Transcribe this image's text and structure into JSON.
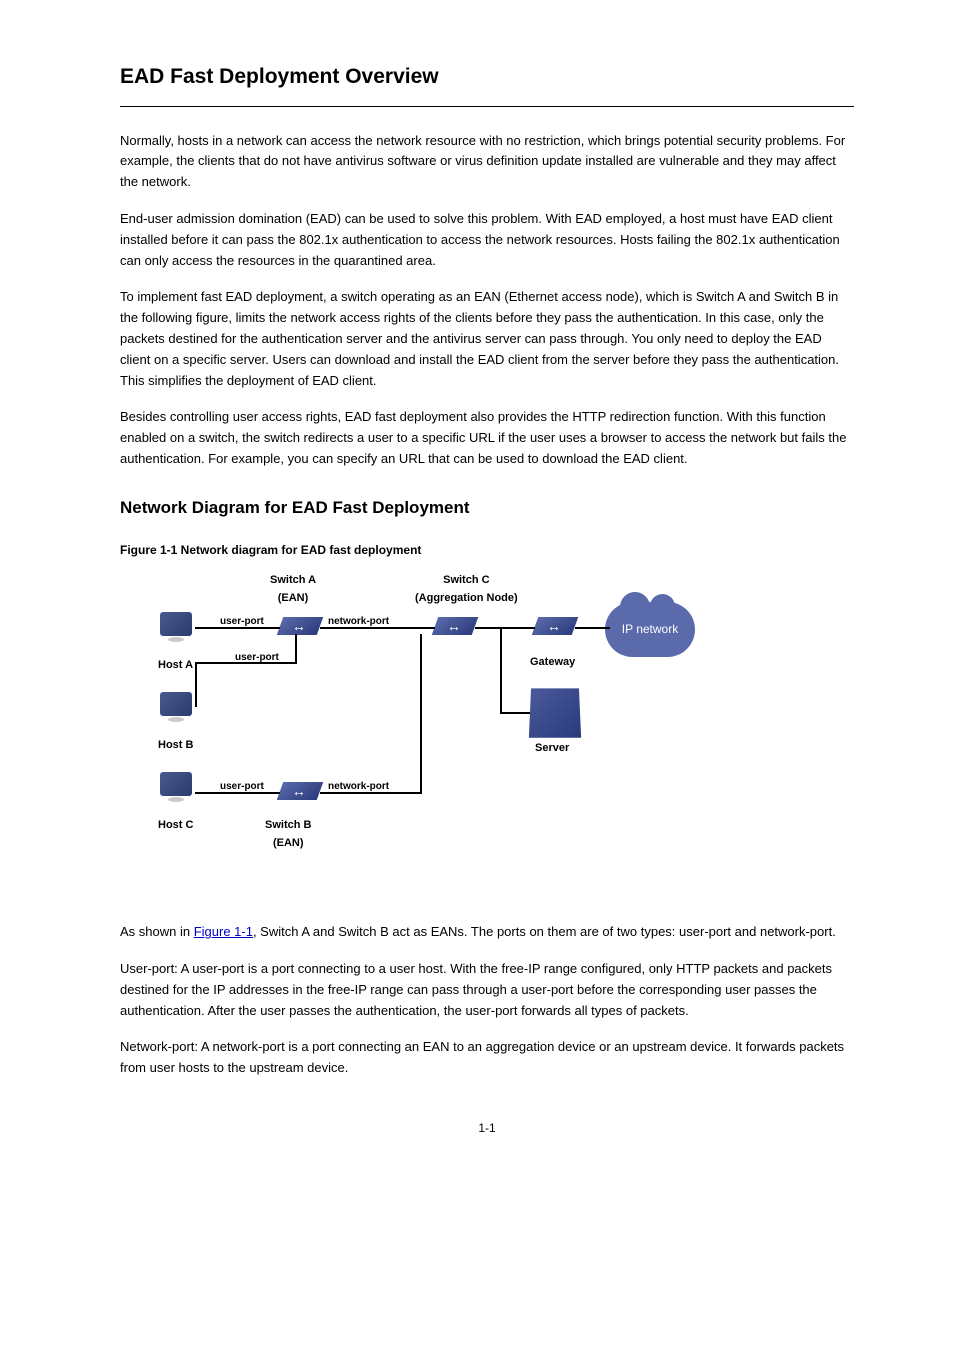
{
  "title": "EAD Fast Deployment Overview",
  "intro_p1": "Normally, hosts in a network can access the network resource with no restriction, which brings potential security problems. For example, the clients that do not have antivirus software or virus definition update installed are vulnerable and they may affect the network.",
  "intro_p2": "End-user admission domination (EAD) can be used to solve this problem. With EAD employed, a host must have EAD client installed before it can pass the 802.1x authentication to access the network resources. Hosts failing the 802.1x authentication can only access the resources in the quarantined area.",
  "intro_p3": "To implement fast EAD deployment, a switch operating as an EAN (Ethernet access node), which is Switch A and Switch B in the following figure, limits the network access rights of the clients before they pass the authentication. In this case, only the packets destined for the authentication server and the antivirus server can pass through. You only need to deploy the EAD client on a specific server. Users can download and install the EAD client from the server before they pass the authentication. This simplifies the deployment of EAD client.",
  "intro_p4": "Besides controlling user access rights, EAD fast deployment also provides the HTTP redirection function. With this function enabled on a switch, the switch redirects a user to a specific URL if the user uses a browser to access the network but fails the authentication. For example, you can specify an URL that can be used to download the EAD client.",
  "section_heading": "Network Diagram for EAD Fast Deployment",
  "figure_caption": "Figure 1-1 Network diagram for EAD fast deployment",
  "diagram": {
    "switch_a": "Switch A\n(EAN)",
    "switch_c": "Switch C\n(Aggregation Node)",
    "switch_b": "Switch B\n(EAN)",
    "host_a": "Host A",
    "host_b": "Host B",
    "host_c": "Host C",
    "gateway": "Gateway",
    "server": "Server",
    "ip_network": "IP network",
    "user_port": "user-port",
    "network_port": "network-port"
  },
  "desc_prefix": "As shown in ",
  "figure_link": "Figure 1-1",
  "desc_suffix": ", Switch A and Switch B act as EANs. The ports on them are of two types: user-port and network-port.",
  "bullet1": "User-port: A user-port is a port connecting to a user host. With the free-IP range configured, only HTTP packets and packets destined for the IP addresses in the free-IP range can pass through a user-port before the corresponding user passes the authentication. After the user passes the authentication, the user-port forwards all types of packets.",
  "bullet2": "Network-port: A network-port is a port connecting an EAN to an aggregation device or an upstream device. It forwards packets from user hosts to the upstream device.",
  "page_number": "1-1"
}
